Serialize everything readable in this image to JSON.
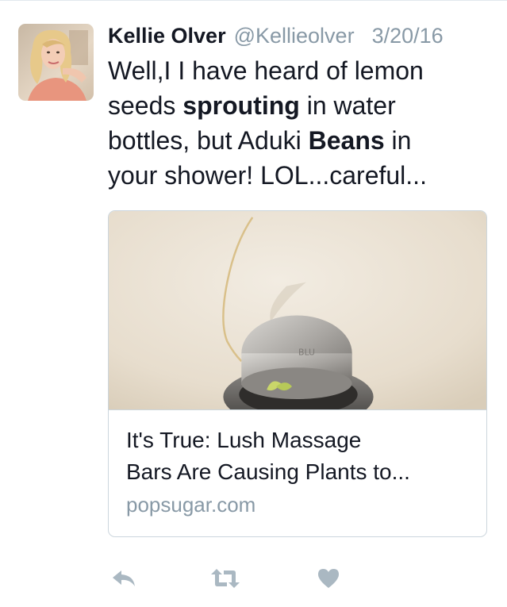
{
  "tweet": {
    "author_name": "Kellie Olver",
    "handle": "@Kellieolver",
    "date": "3/20/16",
    "text_lines": [
      [
        {
          "t": "Well,I I have heard of lemon",
          "b": false
        }
      ],
      [
        {
          "t": "seeds ",
          "b": false
        },
        {
          "t": "sprouting",
          "b": true
        },
        {
          "t": " in water",
          "b": false
        }
      ],
      [
        {
          "t": "bottles, but Aduki ",
          "b": false
        },
        {
          "t": "Beans",
          "b": true
        },
        {
          "t": " in",
          "b": false
        }
      ],
      [
        {
          "t": "your shower!  LOL...careful...",
          "b": false
        }
      ]
    ]
  },
  "card": {
    "title_line1": "It's True: Lush Massage",
    "title_line2": "Bars Are Causing Plants to...",
    "domain": "popsugar.com"
  },
  "actions": {
    "reply_icon": "reply-icon",
    "retweet_icon": "retweet-icon",
    "like_icon": "heart-icon"
  },
  "colors": {
    "muted": "#8899a6",
    "text": "#141823",
    "border": "#ccd6dd",
    "action_icon": "#aab8c2"
  }
}
